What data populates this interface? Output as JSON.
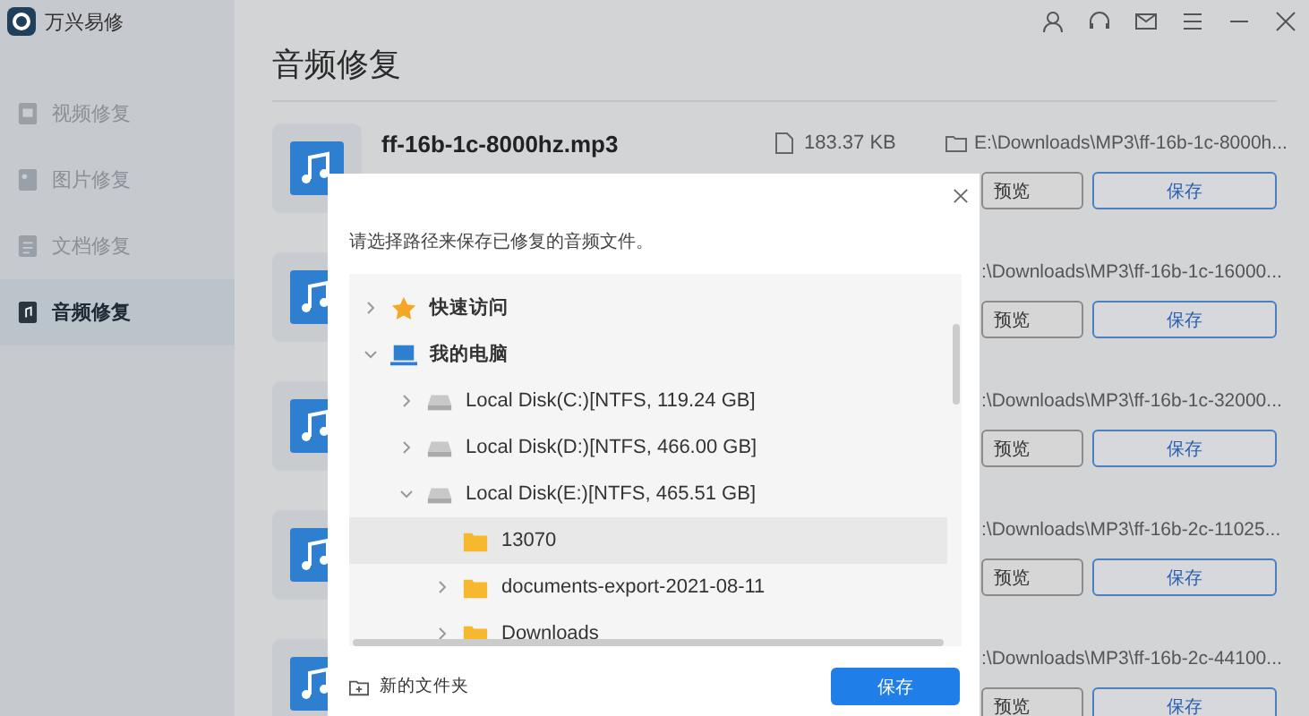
{
  "app": {
    "name": "万兴易修"
  },
  "sidebar": {
    "items": [
      {
        "label": "视频修复",
        "kind": "video",
        "selected": false
      },
      {
        "label": "图片修复",
        "kind": "image",
        "selected": false
      },
      {
        "label": "文档修复",
        "kind": "document",
        "selected": false
      },
      {
        "label": "音频修复",
        "kind": "audio",
        "selected": true
      }
    ]
  },
  "page": {
    "title": "音频修复"
  },
  "files": [
    {
      "kind": "full",
      "name": "ff-16b-1c-8000hz.mp3",
      "size": "183.37  KB",
      "path": "E:\\Downloads\\MP3\\ff-16b-1c-8000h...",
      "preview": "预览",
      "save": "保存"
    },
    {
      "kind": "covered",
      "path": ":\\Downloads\\MP3\\ff-16b-1c-16000...",
      "preview": "预览",
      "save": "保存"
    },
    {
      "kind": "covered",
      "path": ":\\Downloads\\MP3\\ff-16b-1c-32000...",
      "preview": "预览",
      "save": "保存"
    },
    {
      "kind": "covered",
      "path": ":\\Downloads\\MP3\\ff-16b-2c-11025...",
      "preview": "预览",
      "save": "保存"
    },
    {
      "kind": "covered",
      "path": ":\\Downloads\\MP3\\ff-16b-2c-44100...",
      "preview": "预览",
      "save": "保存"
    }
  ],
  "dialog": {
    "prompt": "请选择路径来保存已修复的音频文件。",
    "tree": [
      {
        "label": "快速访问",
        "kind": "star",
        "expanded": false,
        "selected": false
      },
      {
        "label": "我的电脑",
        "kind": "computer",
        "expanded": true,
        "selected": false,
        "children": [
          {
            "label": "Local Disk(C:)[NTFS, 119.24  GB]",
            "kind": "disk",
            "expanded": false,
            "selected": false
          },
          {
            "label": "Local Disk(D:)[NTFS, 466.00  GB]",
            "kind": "disk",
            "expanded": false,
            "selected": false
          },
          {
            "label": "Local Disk(E:)[NTFS, 465.51  GB]",
            "kind": "disk",
            "expanded": true,
            "selected": false,
            "children": [
              {
                "label": "13070",
                "kind": "folder",
                "selected": true
              },
              {
                "label": "documents-export-2021-08-11",
                "kind": "folder",
                "expanded": false,
                "selected": false
              },
              {
                "label": "Downloads",
                "kind": "folder",
                "expanded": false,
                "selected": false
              }
            ]
          }
        ]
      }
    ],
    "new_folder": "新的文件夹",
    "save": "保存"
  }
}
